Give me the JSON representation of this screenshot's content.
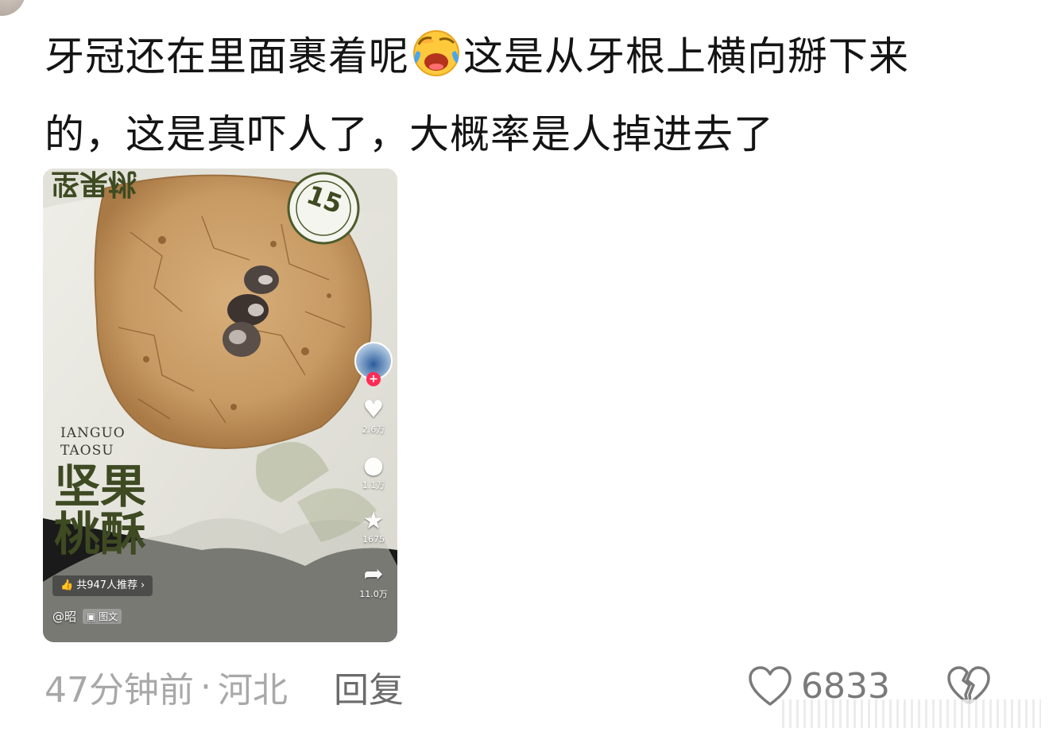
{
  "comment": {
    "line1_before_emoji": "牙冠还在里面裹着呢",
    "emoji": "crying-laughing-emoji",
    "line1_after_emoji": "这是从牙根上横向掰下来",
    "line2": "的，这是真吓人了，大概率是人掉进去了"
  },
  "media": {
    "brand_en_line1": "IANGUO",
    "brand_en_line2": "TAOSU",
    "brand_cn": "坚果桃酥",
    "badge_number": "15",
    "recommend_label": "共947人推荐",
    "recommend_chevron": "›",
    "author": "@昭",
    "post_type": "图文",
    "like_count": "2.6万",
    "comment_count": "1.1万",
    "favorite_count": "1675",
    "share_count": "11.0万"
  },
  "meta": {
    "time": "47分钟前",
    "separator": "·",
    "location": "河北",
    "reply_label": "回复",
    "like_count": "6833"
  }
}
